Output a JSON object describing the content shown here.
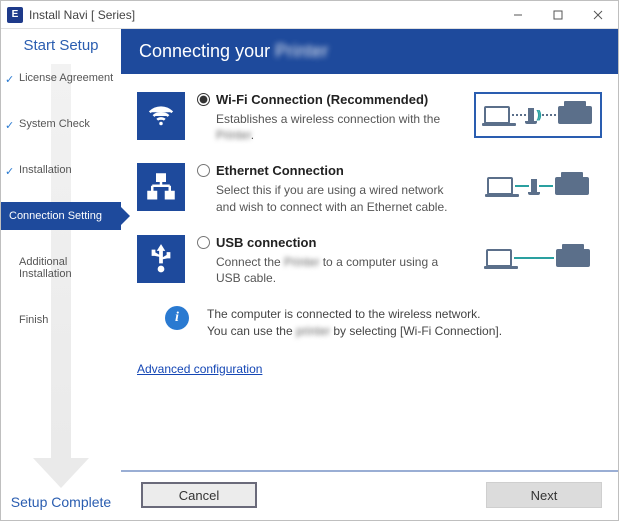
{
  "window": {
    "title": "Install Navi [          Series]"
  },
  "sidebar": {
    "top_label": "Start Setup",
    "bottom_label": "Setup Complete",
    "steps": [
      {
        "label": "License Agreement",
        "done": true
      },
      {
        "label": "System Check",
        "done": true
      },
      {
        "label": "Installation",
        "done": true
      },
      {
        "label": "Connection Setting",
        "current": true
      },
      {
        "label": "Additional Installation"
      },
      {
        "label": "Finish"
      }
    ]
  },
  "header": {
    "prefix": "Connecting your ",
    "blurred": "Printer"
  },
  "options": {
    "wifi": {
      "title": "Wi-Fi Connection (Recommended)",
      "desc_prefix": "Establishes a wireless connection with the ",
      "desc_blurred": "Printer",
      "desc_suffix": "."
    },
    "ethernet": {
      "title": "Ethernet Connection",
      "desc": "Select this if you are using a wired network and wish to connect with an Ethernet cable."
    },
    "usb": {
      "title": "USB connection",
      "desc_prefix": "Connect the ",
      "desc_blurred": "Printer",
      "desc_suffix": " to a computer using a USB cable."
    }
  },
  "info": {
    "line1": "The computer is connected to the wireless network.",
    "line2_prefix": "You can use the ",
    "line2_blurred": "printer",
    "line2_suffix": " by selecting [Wi-Fi Connection]."
  },
  "links": {
    "advanced": "Advanced configuration"
  },
  "buttons": {
    "cancel": "Cancel",
    "next": "Next"
  },
  "icons": {
    "app_badge": "E"
  }
}
